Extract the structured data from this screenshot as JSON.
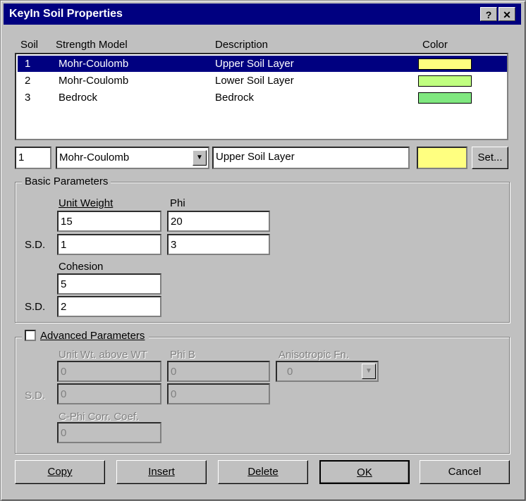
{
  "window": {
    "title": "KeyIn Soil Properties",
    "help_btn": "?",
    "close_btn": "✕"
  },
  "columns": {
    "soil": "Soil",
    "strength": "Strength Model",
    "description": "Description",
    "color": "Color"
  },
  "soils": [
    {
      "num": "1",
      "model": "Mohr-Coulomb",
      "desc": "Upper Soil Layer",
      "color": "#ffff80"
    },
    {
      "num": "2",
      "model": "Mohr-Coulomb",
      "desc": "Lower Soil Layer",
      "color": "#c0ff80"
    },
    {
      "num": "3",
      "model": "Bedrock",
      "desc": "Bedrock",
      "color": "#80e880"
    }
  ],
  "edit": {
    "num": "1",
    "model": "Mohr-Coulomb",
    "desc": "Upper Soil Layer",
    "color": "#ffff80",
    "set_label": "Set..."
  },
  "basic": {
    "label": "Basic Parameters",
    "unit_weight_label": "Unit Weight",
    "unit_weight": "15",
    "unit_weight_sd": "1",
    "phi_label": "Phi",
    "phi": "20",
    "phi_sd": "3",
    "cohesion_label": "Cohesion",
    "cohesion": "5",
    "cohesion_sd": "2",
    "sd_label": "S.D."
  },
  "advanced": {
    "label": "Advanced Parameters",
    "unit_wt_label": "Unit Wt. above WT",
    "unit_wt": "0",
    "unit_wt_sd": "0",
    "phib_label": "Phi B",
    "phib": "0",
    "phib_sd": "0",
    "aniso_label": "Anisotropic Fn.",
    "aniso": "0",
    "cphi_label": "C-Phi Corr. Coef.",
    "cphi": "0",
    "sd_label": "S.D."
  },
  "buttons": {
    "copy": "Copy",
    "insert": "Insert",
    "delete": "Delete",
    "ok": "OK",
    "cancel": "Cancel"
  }
}
